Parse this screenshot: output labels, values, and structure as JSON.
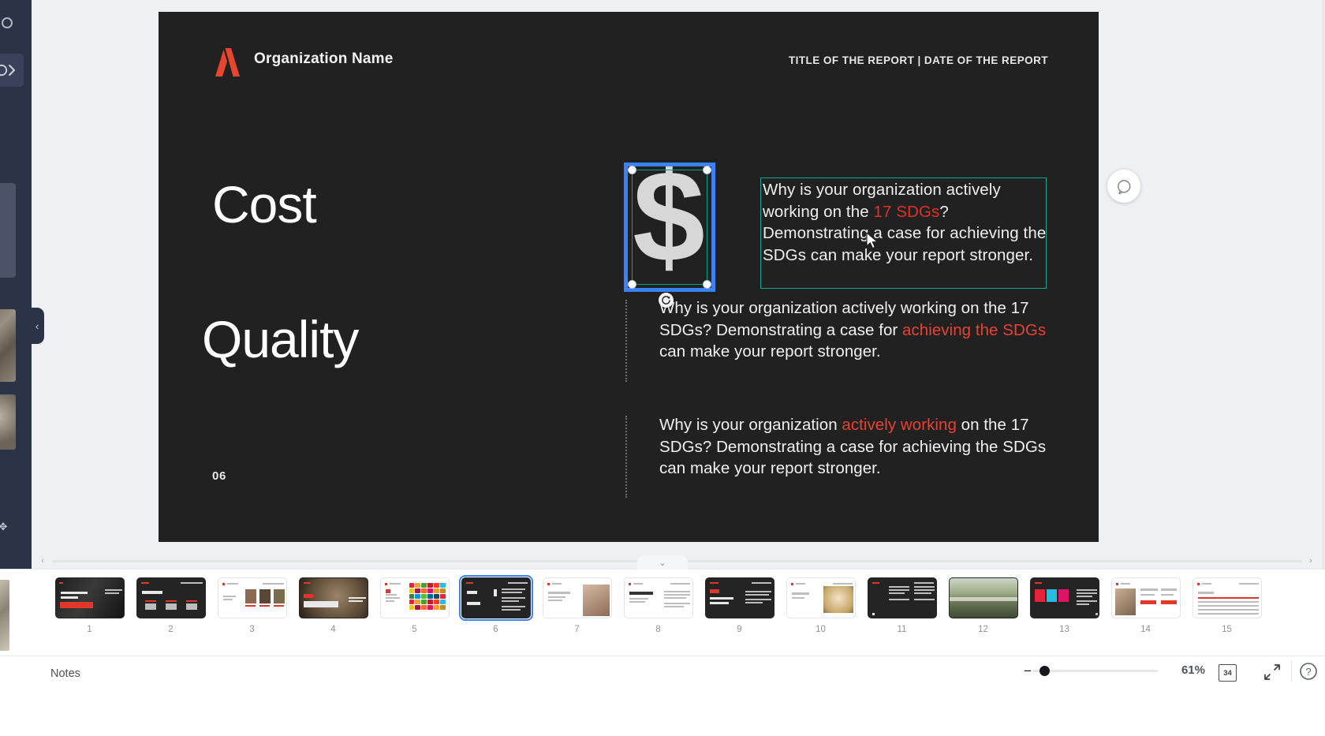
{
  "app": {
    "notes_label": "Notes",
    "zoom_percent": "61%",
    "slide_count": "34"
  },
  "left_rail": {
    "expand_icon": "chevron-right-icon",
    "collapse_icon": "‹",
    "move_handle_icon": "✥",
    "dot_icon": "circle-icon"
  },
  "canvas": {
    "comment_icon": "comment-bubble-icon",
    "scroll_left_icon": "‹",
    "scroll_right_icon": "›",
    "filmstrip_toggle_icon": "⌄"
  },
  "slide": {
    "logo_name": "organization-logo-icon",
    "logo_color": "#e8452e",
    "organization_name": "Organization Name",
    "report_meta": "TITLE OF THE REPORT | DATE OF THE REPORT",
    "keyword_1": "Cost",
    "keyword_2": "Quality",
    "page_number": "06",
    "accent_color": "#e03127",
    "background_color": "#212121",
    "graphic": {
      "name": "dollar-sign-icon",
      "symbol": "$"
    },
    "selected_textbox": {
      "line1_a": "Why is your organization actively",
      "line2_a": "working on the ",
      "line2_hl": "17 SDGs",
      "line2_b": "?",
      "line3": "Demonstrating a case for achieving",
      "line4": "the SDGs can make your report",
      "line5": "stronger."
    },
    "block_2": {
      "part1": "Why is your organization actively working on the 17 SDGs? Demonstrating a case for ",
      "highlight": "achieving the SDGs",
      "part2": " can make your report stronger."
    },
    "block_3": {
      "part1": "Why is your organization ",
      "highlight": "actively working",
      "part2": " on the 17 SDGs? Demonstrating a case for achieving the SDGs can make your report stronger."
    }
  },
  "selection": {
    "drag_outline_color": "#3b82f6",
    "selection_border_color": "#12a594",
    "rotate_icon": "rotate-icon"
  },
  "filmstrip": {
    "selected_index": 6,
    "slides": [
      {
        "num": "1",
        "style": "dark-photo"
      },
      {
        "num": "2",
        "style": "dark-chart"
      },
      {
        "num": "3",
        "style": "light-people"
      },
      {
        "num": "4",
        "style": "dark-bear"
      },
      {
        "num": "5",
        "style": "light-sdg"
      },
      {
        "num": "6",
        "style": "dark-costquality"
      },
      {
        "num": "7",
        "style": "light-portrait"
      },
      {
        "num": "8",
        "style": "light-text"
      },
      {
        "num": "9",
        "style": "dark-report"
      },
      {
        "num": "10",
        "style": "light-food"
      },
      {
        "num": "11",
        "style": "dark-columns"
      },
      {
        "num": "12",
        "style": "photo-landscape"
      },
      {
        "num": "13",
        "style": "dark-cards"
      },
      {
        "num": "14",
        "style": "light-mixed"
      },
      {
        "num": "15",
        "style": "light-table"
      }
    ]
  },
  "bottom_bar": {
    "zoom_out_icon": "minus-icon",
    "slide_count_icon": "slide-count-icon",
    "expand_icon": "expand-arrows-icon",
    "help_icon": "help-question-icon"
  }
}
